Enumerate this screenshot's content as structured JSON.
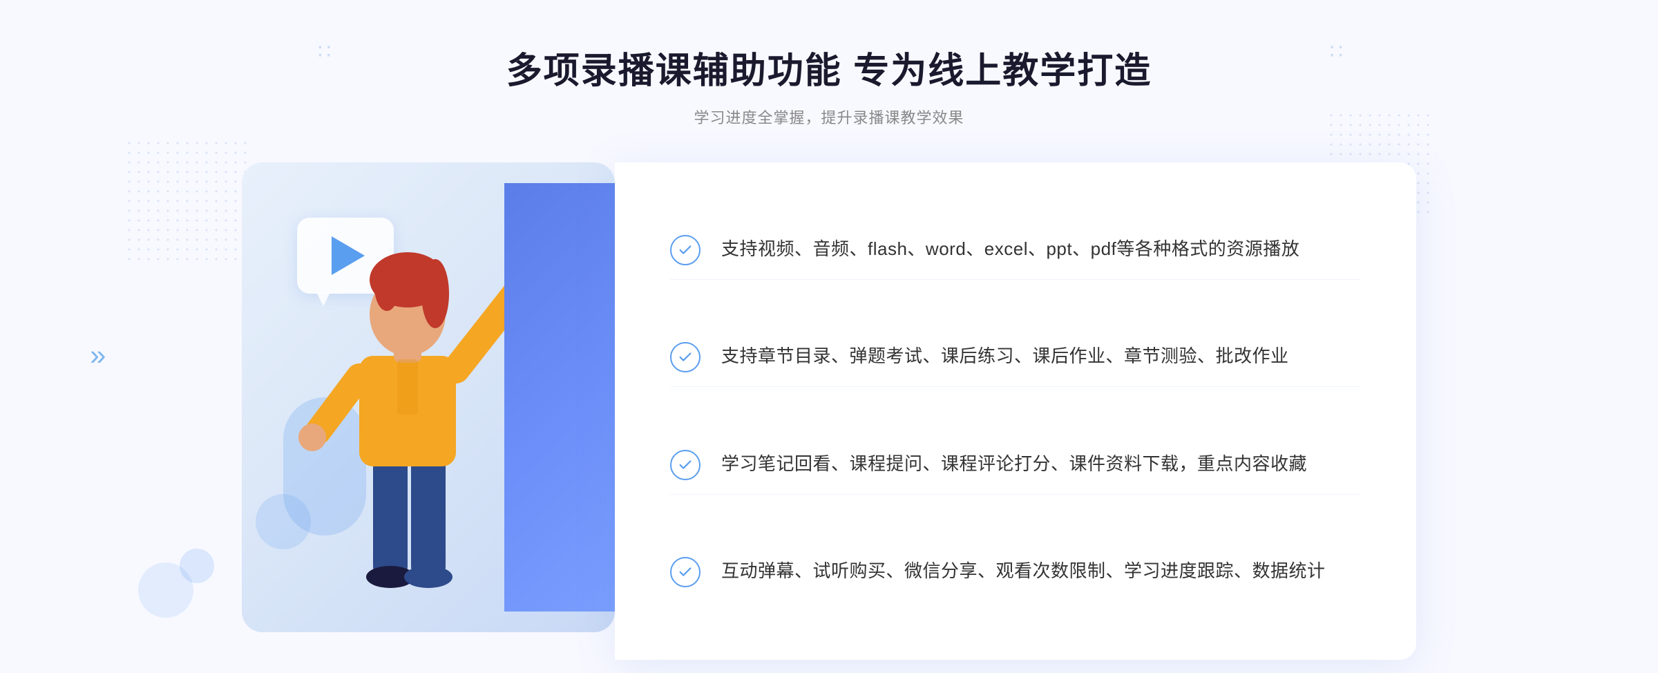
{
  "header": {
    "main_title": "多项录播课辅助功能 专为线上教学打造",
    "sub_title": "学习进度全掌握，提升录播课教学效果"
  },
  "features": [
    {
      "id": 1,
      "text": "支持视频、音频、flash、word、excel、ppt、pdf等各种格式的资源播放"
    },
    {
      "id": 2,
      "text": "支持章节目录、弹题考试、课后练习、课后作业、章节测验、批改作业"
    },
    {
      "id": 3,
      "text": "学习笔记回看、课程提问、课程评论打分、课件资料下载，重点内容收藏"
    },
    {
      "id": 4,
      "text": "互动弹幕、试听购买、微信分享、观看次数限制、学习进度跟踪、数据统计"
    }
  ],
  "decorative": {
    "chevron_left": "»",
    "chevron_dots_left": "⁞⁞",
    "chevron_dots_right": "⁞⁞"
  }
}
